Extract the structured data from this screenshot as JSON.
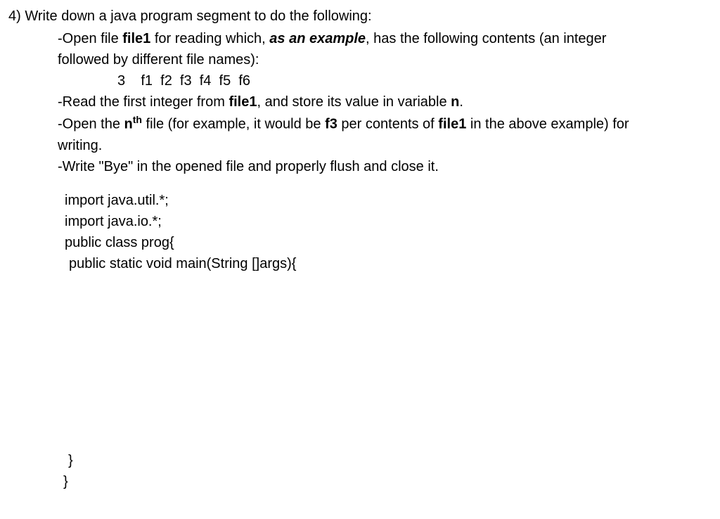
{
  "question": {
    "number": "4)",
    "prompt": "Write down a java program segment to do the following:",
    "bullet1_pre": "-Open file ",
    "bullet1_file": "file1",
    "bullet1_mid": " for reading which, ",
    "bullet1_em": "as an example",
    "bullet1_post": ", has the following contents (an integer",
    "bullet1_line2": "followed by different file names):",
    "example_content": "3    f1  f2  f3  f4  f5  f6",
    "bullet2_pre": "-Read the first integer from ",
    "bullet2_file": "file1",
    "bullet2_mid": ", and store its value in variable ",
    "bullet2_var": "n",
    "bullet2_post": ".",
    "bullet3_pre": "-Open the ",
    "bullet3_n": "n",
    "bullet3_sup": "th",
    "bullet3_mid": " file (for example, it would be ",
    "bullet3_f3": "f3",
    "bullet3_mid2": " per contents of ",
    "bullet3_file": "file1",
    "bullet3_post": " in the above example) for",
    "bullet3_line2": "writing.",
    "bullet4": "-Write \"Bye\" in the opened file and properly flush and close it."
  },
  "code": {
    "line1": "import java.util.*;",
    "line2": "import java.io.*;",
    "line3": "public class prog{",
    "line4": "public static void main(String []args){",
    "close1": "}",
    "close2": "}"
  }
}
